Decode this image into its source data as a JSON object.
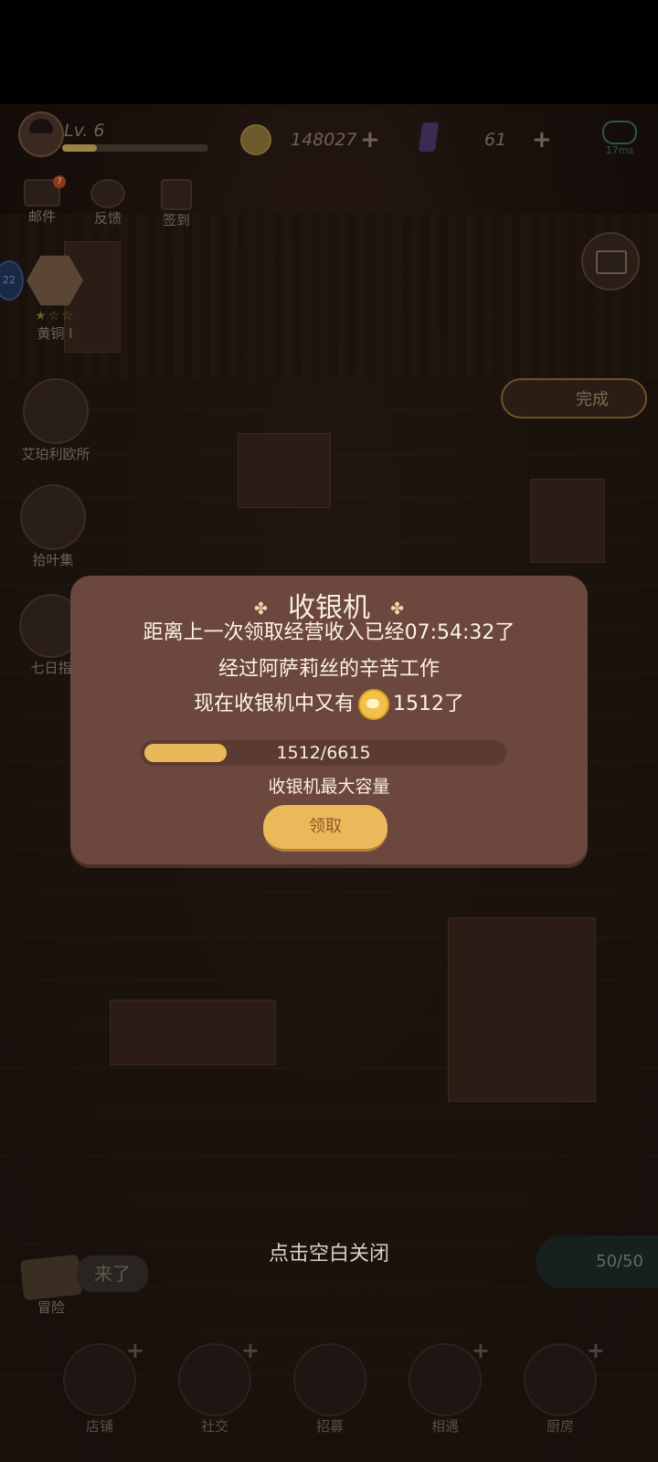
{
  "topbar": {
    "level": "Lv. 6",
    "xp_fraction": 0.24,
    "gold": "148027",
    "gems": "61",
    "ping": "17ms"
  },
  "side": {
    "mail": "邮件",
    "mail_badge": "7",
    "feedback": "反馈",
    "checkin": "签到",
    "rank": "黄铜 I",
    "shop": "艾珀利欧所",
    "collect": "拾叶集",
    "seven_day": "七日指",
    "level_bubble": "22"
  },
  "right": {
    "done_label": "完成",
    "energy": "50/50"
  },
  "dialog": {
    "title": "收银机",
    "line1": "距离上一次领取经营收入已经07:54:32了",
    "line2": "经过阿萨莉丝的辛苦工作",
    "line3_prefix": "现在收银机中又有",
    "line3_amount": "1512了",
    "capacity_text": "1512/6615",
    "capacity_fraction": 0.2286,
    "capacity_label": "收银机最大容量",
    "claim_label": "领取"
  },
  "close_hint": "点击空白关闭",
  "bottom": {
    "adventure": "冒险",
    "bubble": "来了",
    "nav": [
      "店铺",
      "社交",
      "招募",
      "相遇",
      "厨房"
    ]
  },
  "colors": {
    "dialog_bg": "#6b473d",
    "accent_gold": "#ebb85a"
  }
}
